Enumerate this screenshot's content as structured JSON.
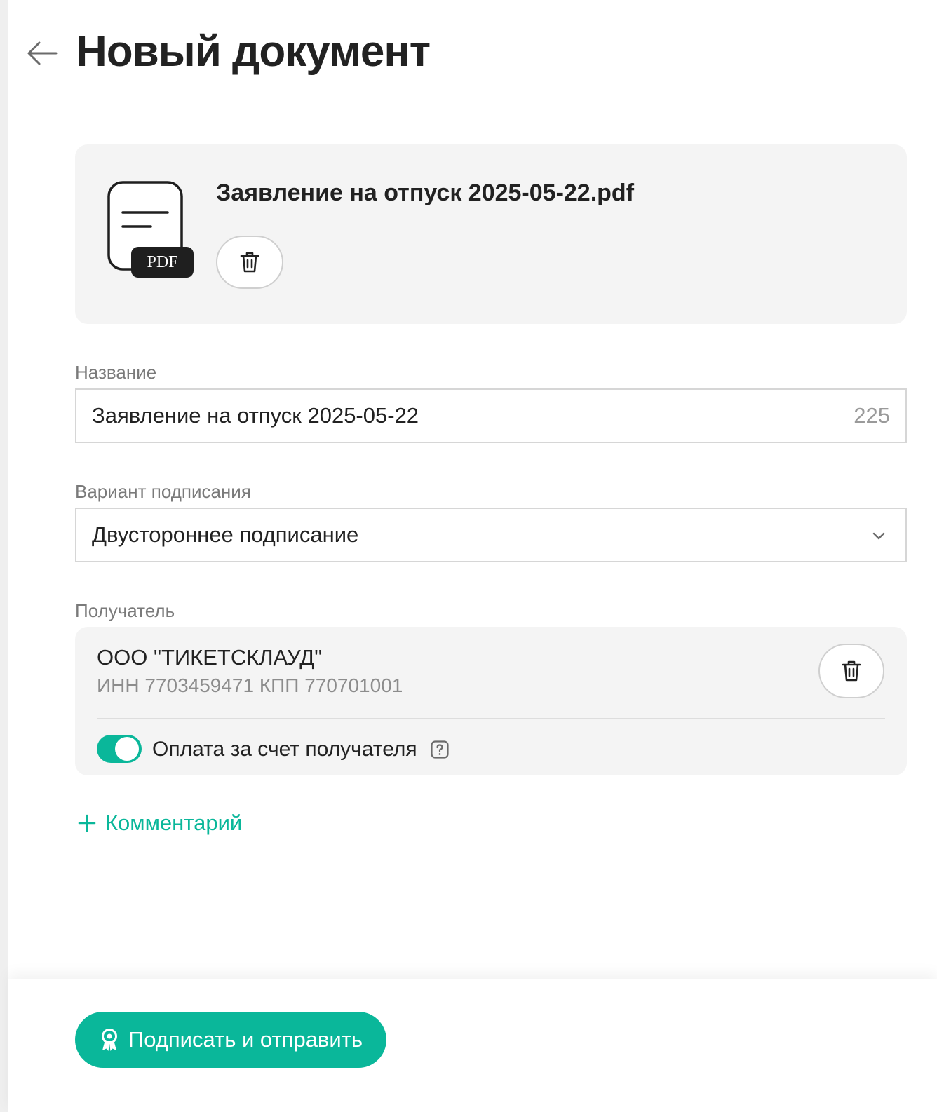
{
  "header": {
    "title": "Новый документ",
    "back_icon": "arrow-left-icon"
  },
  "file": {
    "name": "Заявление на отпуск 2025-05-22.pdf",
    "badge": "PDF",
    "icon": "pdf-file-icon",
    "delete_icon": "trash-icon"
  },
  "form": {
    "name_label": "Название",
    "name_value": "Заявление на отпуск 2025-05-22",
    "name_counter": "225",
    "signing_label": "Вариант подписания",
    "signing_value": "Двустороннее подписание",
    "recipient_label": "Получатель"
  },
  "recipient": {
    "name": "ООО \"ТИКЕТСКЛАУД\"",
    "details": "ИНН 7703459471 КПП 770701001",
    "payment_label": "Оплата за счет получателя",
    "payment_enabled": true,
    "help_icon": "question-icon"
  },
  "comment": {
    "label": "Комментарий",
    "icon": "plus-icon"
  },
  "actions": {
    "submit_label": "Подписать и отправить",
    "submit_icon": "award-icon"
  },
  "colors": {
    "accent": "#0ab79a",
    "card_bg": "#f4f4f4",
    "muted_text": "#7a7a7a"
  }
}
